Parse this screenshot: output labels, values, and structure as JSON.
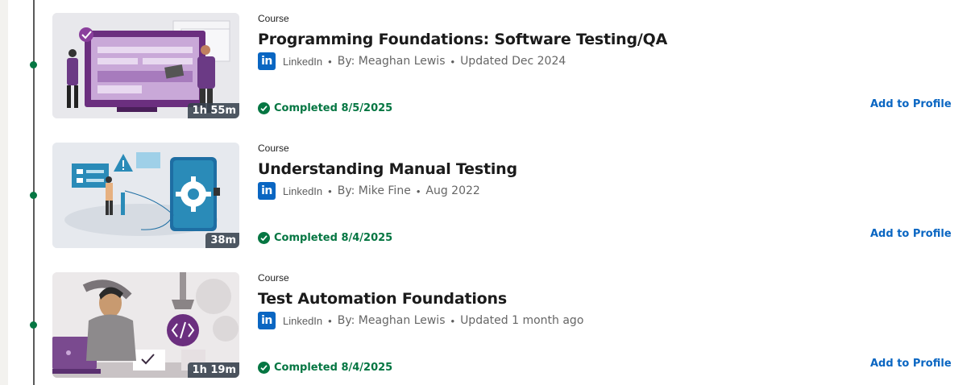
{
  "courses": [
    {
      "type": "Course",
      "title": "Programming Foundations: Software Testing/QA",
      "logo": "in",
      "provider": "LinkedIn",
      "bullet": "•",
      "author": "By: Meaghan Lewis",
      "date": "Updated Dec 2024",
      "duration": "1h 55m",
      "completed": "Completed 8/5/2025",
      "action": "Add to Profile"
    },
    {
      "type": "Course",
      "title": "Understanding Manual Testing",
      "logo": "in",
      "provider": "LinkedIn",
      "bullet": "•",
      "author": "By: Mike Fine",
      "date": "Aug 2022",
      "duration": "38m",
      "completed": "Completed 8/4/2025",
      "action": "Add to Profile"
    },
    {
      "type": "Course",
      "title": "Test Automation Foundations",
      "logo": "in",
      "provider": "LinkedIn",
      "bullet": "•",
      "author": "By: Meaghan Lewis",
      "date": "Updated 1 month ago",
      "duration": "1h 19m",
      "completed": "Completed 8/4/2025",
      "action": "Add to Profile"
    }
  ],
  "colors": {
    "accent": "#0a66c2",
    "success": "#057642",
    "timeline": "#5a5a5a"
  }
}
